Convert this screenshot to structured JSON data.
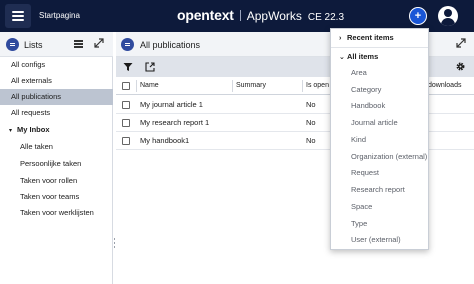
{
  "topbar": {
    "breadcrumb": "Startpagina",
    "brand_logo": "opentext",
    "brand_product": "AppWorks",
    "brand_version": "CE 22.3",
    "new_button_symbol": "+"
  },
  "left_panel": {
    "title": "Lists",
    "items": [
      {
        "label": "All configs",
        "selected": false
      },
      {
        "label": "All externals",
        "selected": false
      },
      {
        "label": "All publications",
        "selected": true
      },
      {
        "label": "All requests",
        "selected": false
      }
    ],
    "inbox": {
      "label": "My Inbox",
      "items": [
        {
          "label": "Alle taken"
        },
        {
          "label": "Persoonlijke taken"
        },
        {
          "label": "Taken voor rollen"
        },
        {
          "label": "Taken voor teams"
        },
        {
          "label": "Taken voor werklijsten"
        }
      ]
    }
  },
  "main_panel": {
    "title": "All publications",
    "columns": {
      "name": "Name",
      "summary": "Summary",
      "is_open": "Is open",
      "downloads": "downloads"
    },
    "rows": [
      {
        "name": "My journal article 1",
        "is_open": "No"
      },
      {
        "name": "My research report 1",
        "is_open": "No"
      },
      {
        "name": "My handbook1",
        "is_open": "No"
      }
    ]
  },
  "dropdown": {
    "recent_label": "Recent items",
    "all_label": "All items",
    "items": [
      "Area",
      "Category",
      "Handbook",
      "Journal article",
      "Kind",
      "Organization (external)",
      "Request",
      "Research report",
      "Space",
      "Type",
      "User (external)"
    ]
  },
  "colors": {
    "topbar_bg": "#0d1a3b",
    "accent": "#1a56d6",
    "selected_row": "#bcc4d1",
    "toolbar_bg": "#dfe3ea"
  }
}
